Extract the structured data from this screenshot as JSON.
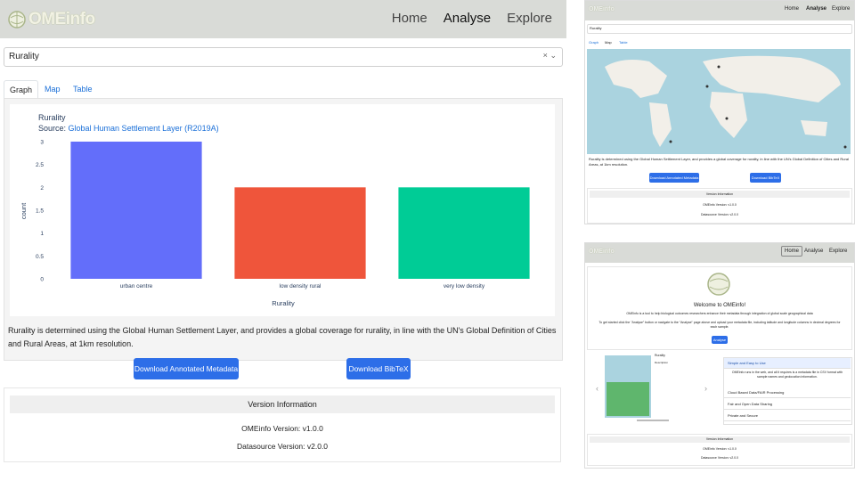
{
  "brand": {
    "name": "OMEinfo"
  },
  "nav": {
    "home": "Home",
    "analyse": "Analyse",
    "explore": "Explore"
  },
  "dataset_select": {
    "value": "Rurality",
    "clear": "×",
    "chevron": "⌄"
  },
  "tabs": {
    "graph": "Graph",
    "map": "Map",
    "table": "Table"
  },
  "chart_data": {
    "type": "bar",
    "title": "Rurality",
    "source_prefix": "Source: ",
    "source_link": "Global Human Settlement Layer (R2019A)",
    "categories": [
      "urban centre",
      "low density rural",
      "very low density"
    ],
    "values": [
      3,
      2,
      2
    ],
    "colors": [
      "#636efa",
      "#ef553b",
      "#00cc96"
    ],
    "xlabel": "Rurality",
    "ylabel": "count",
    "ylim": [
      0,
      3
    ],
    "yticks": [
      "0",
      "0.5",
      "1",
      "1.5",
      "2",
      "2.5",
      "3"
    ],
    "grid": false
  },
  "description": "Rurality is determined using the Global Human Settlement Layer, and provides a global coverage for rurality, in line with the UN's Global Definition of Cities and Rural Areas, at 1km resolution.",
  "buttons": {
    "download_metadata": "Download Annotated Metadata",
    "download_bibtex": "Download BibTeX"
  },
  "version": {
    "heading": "Version Information",
    "omeinfo": "OMEinfo Version: v1.0.0",
    "datasource": "Datasource Version: v2.0.0"
  },
  "thumb_home": {
    "welcome": "Welcome to OMEinfo!",
    "intro": "OMEinfo is a tool to help biological outcomes researchers enhance their metadata through integration of global scale geographical data",
    "instructions": "To get started click the \"Analyse\" button or navigate to the \"Analyse\" page above and upload your metadata file, including latitude and longitude columns in decimal degrees for each sample.",
    "analyse_btn": "Analyse",
    "carousel_title": "Rurality",
    "carousel_sub": "Description",
    "prev": "‹",
    "next": "›",
    "accordion": [
      "Simple and Easy to Use",
      "Cloud Based Data/FAIR Processing",
      "Fair and Open Data Sharing",
      "Private and Secure"
    ],
    "accordion_body": "OMEinfo runs in the web, and all it requires is a metadata file in CSV format with sample names and geolocation information."
  }
}
